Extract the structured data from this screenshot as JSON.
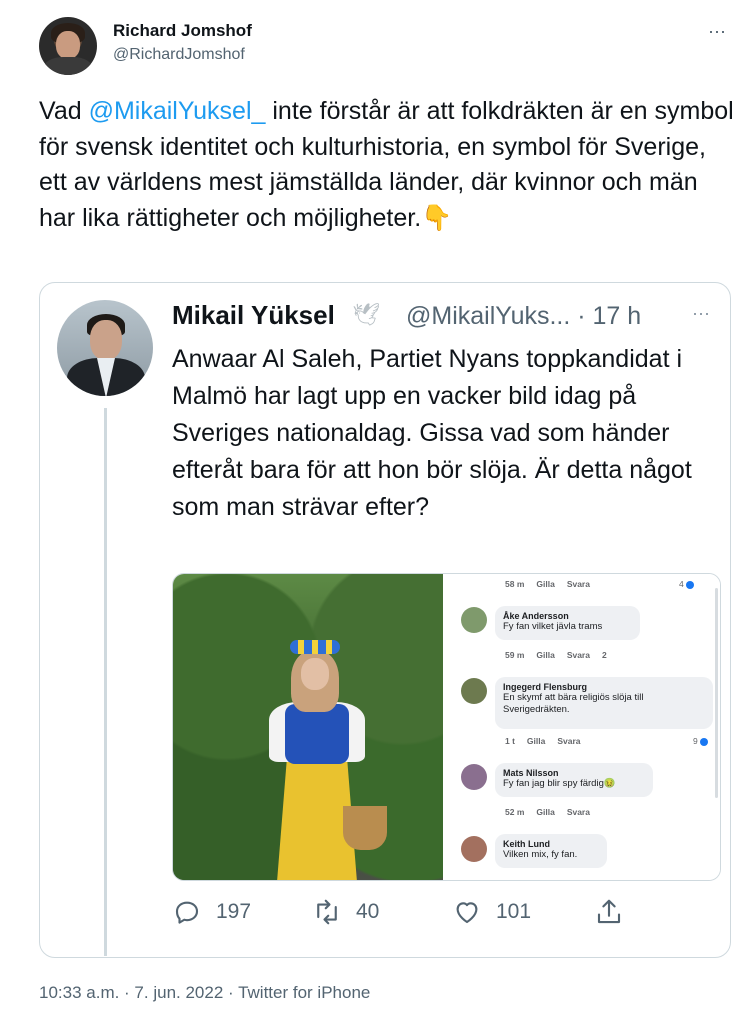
{
  "tweet": {
    "author_name": "Richard Jomshof",
    "author_handle": "@RichardJomshof",
    "more_icon": "⋯",
    "text_before_mention": "Vad ",
    "mention": "@MikailYuksel_",
    "text_after_mention": " inte förstår är att folkdräkten är en symbol för svensk identitet och kulturhistoria, en symbol för Sverige, ett av världens mest jämställda länder, där kvinnor och män har lika rättigheter och möjligheter.",
    "emoji": "👇",
    "footer": "10:33 a.m. · 7. jun. 2022 · Twitter for iPhone"
  },
  "quoted": {
    "author_name": "Mikail Yüksel",
    "dove_icon": "🕊",
    "handle_time": "@MikailYuks... · 17 h",
    "more_icon": "⋯",
    "text": "Anwaar Al Saleh, Partiet Nyans toppkandidat i Malmö har lagt upp en vacker bild idag på Sveriges nationaldag. Gissa vad som händer efteråt bara för att hon bör slöja. Är detta något som man strävar efter?",
    "comments_top_meta": {
      "time": "58 m",
      "like": "Gilla",
      "reply": "Svara",
      "react": "4"
    },
    "comments": [
      {
        "name": "Åke Andersson",
        "message": "Fy fan vilket jävla trams",
        "time": "59 m",
        "like": "Gilla",
        "reply": "Svara",
        "react": "2",
        "color": "#7f9a6c"
      },
      {
        "name": "Ingegerd Flensburg",
        "message": "En skymf att bära religiös slöja till Sverigedräkten.",
        "time": "1 t",
        "like": "Gilla",
        "reply": "Svara",
        "react": "9",
        "color": "#6d7a4f"
      },
      {
        "name": "Mats Nilsson",
        "message": "Fy fan jag blir spy färdig🤢",
        "time": "52 m",
        "like": "Gilla",
        "reply": "Svara",
        "react": "",
        "color": "#8a6f8f"
      },
      {
        "name": "Keith Lund",
        "message": "Vilken mix, fy fan.",
        "time": "",
        "like": "",
        "reply": "",
        "react": "",
        "color": "#a3705f"
      }
    ],
    "actions": {
      "replies": "197",
      "retweets": "40",
      "likes": "101"
    }
  },
  "icons": {
    "reply": "reply-icon",
    "retweet": "retweet-icon",
    "like": "heart-icon",
    "share": "share-icon"
  },
  "colors": {
    "link": "#1d9bf0",
    "secondary": "#536471",
    "border": "#cfd9de"
  }
}
